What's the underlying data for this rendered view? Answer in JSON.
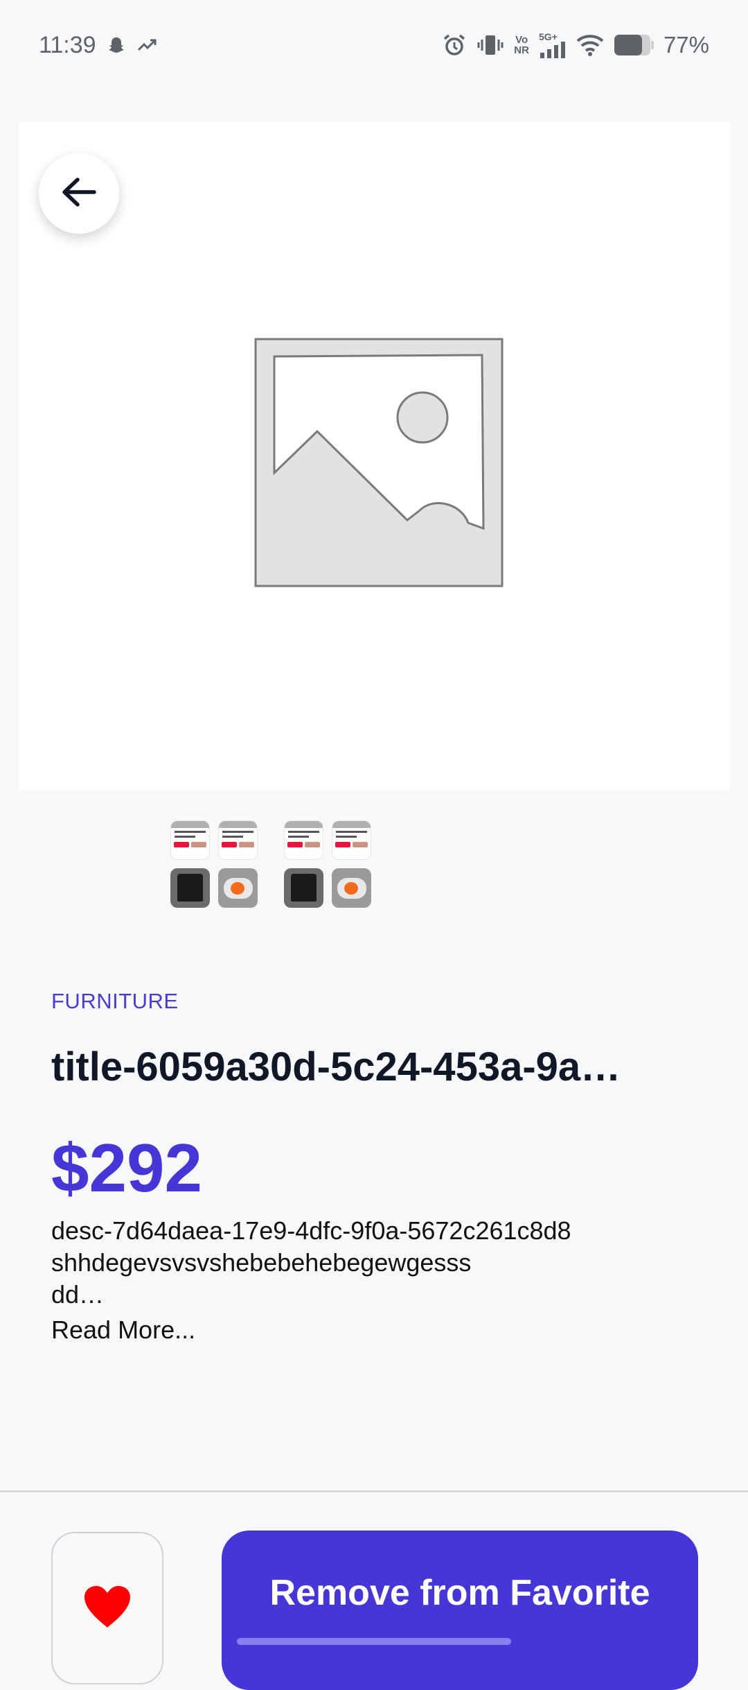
{
  "status_bar": {
    "time": "11:39",
    "battery_percent": "77%",
    "icons": [
      "snapchat-icon",
      "trend-icon",
      "alarm-icon",
      "vibrate-icon",
      "volte-icon",
      "signal-5g-icon",
      "wifi-icon",
      "battery-icon"
    ],
    "network_label_top": "Vo",
    "network_label_bottom": "NR",
    "network_type": "5G+"
  },
  "product": {
    "category": "FURNITURE",
    "title": "title-6059a30d-5c24-453a-9a…",
    "price": "$292",
    "description_lines": [
      "desc-7d64daea-17e9-4dfc-9f0a-5672c261c8d8",
      "shhdegevsvsvshebebehebegewgesss",
      "dd…"
    ],
    "read_more_label": "Read More...",
    "image_icon": "image-placeholder-icon",
    "thumbnail_groups": 2
  },
  "actions": {
    "remove_label": "Remove from Favorite",
    "favorite_icon": "heart-icon",
    "back_icon": "arrow-left-icon"
  },
  "colors": {
    "accent": "#4636d6",
    "heart": "#ff0000",
    "background": "#f7f8fa"
  }
}
